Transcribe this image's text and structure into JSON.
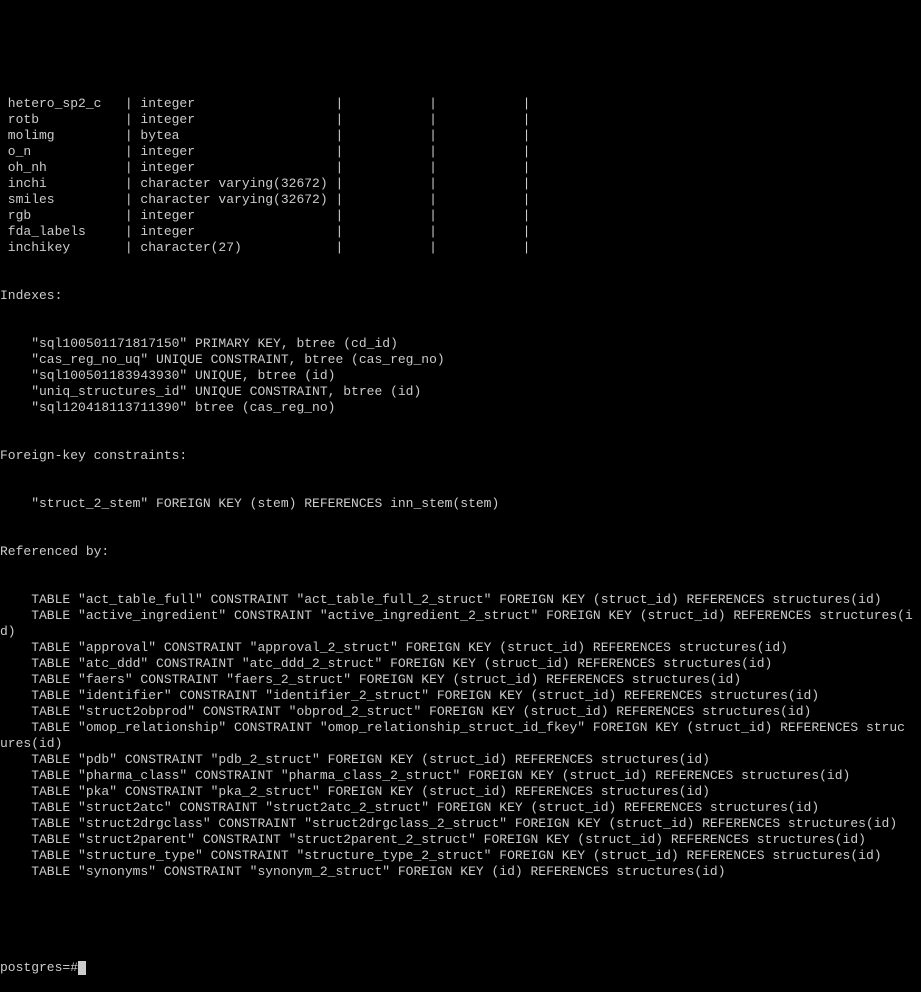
{
  "columns": [
    {
      "name": "hetero_sp2_c",
      "type": "integer",
      "md": "",
      "rest": "|           |"
    },
    {
      "name": "rotb",
      "type": "integer",
      "md": "",
      "rest": "|           |"
    },
    {
      "name": "molimg",
      "type": "bytea",
      "md": "",
      "rest": "|           |"
    },
    {
      "name": "o_n",
      "type": "integer",
      "md": "",
      "rest": "|           |"
    },
    {
      "name": "oh_nh",
      "type": "integer",
      "md": "",
      "rest": "|           |"
    },
    {
      "name": "inchi",
      "type": "character varying(32672)",
      "md": "",
      "rest": "|           |"
    },
    {
      "name": "smiles",
      "type": "character varying(32672)",
      "md": "",
      "rest": "|           |"
    },
    {
      "name": "rgb",
      "type": "integer",
      "md": "",
      "rest": "|           |"
    },
    {
      "name": "fda_labels",
      "type": "integer",
      "md": "",
      "rest": "|           |"
    },
    {
      "name": "inchikey",
      "type": "character(27)",
      "md": "",
      "rest": "|           |"
    }
  ],
  "indexes_header": "Indexes:",
  "indexes": [
    "    \"sql100501171817150\" PRIMARY KEY, btree (cd_id)",
    "    \"cas_reg_no_uq\" UNIQUE CONSTRAINT, btree (cas_reg_no)",
    "    \"sql100501183943930\" UNIQUE, btree (id)",
    "    \"uniq_structures_id\" UNIQUE CONSTRAINT, btree (id)",
    "    \"sql120418113711390\" btree (cas_reg_no)"
  ],
  "fk_header": "Foreign-key constraints:",
  "fk": [
    "    \"struct_2_stem\" FOREIGN KEY (stem) REFERENCES inn_stem(stem)"
  ],
  "ref_header": "Referenced by:",
  "refs": [
    "    TABLE \"act_table_full\" CONSTRAINT \"act_table_full_2_struct\" FOREIGN KEY (struct_id) REFERENCES structures(id)",
    "    TABLE \"active_ingredient\" CONSTRAINT \"active_ingredient_2_struct\" FOREIGN KEY (struct_id) REFERENCES structures(i",
    "d)",
    "    TABLE \"approval\" CONSTRAINT \"approval_2_struct\" FOREIGN KEY (struct_id) REFERENCES structures(id)",
    "    TABLE \"atc_ddd\" CONSTRAINT \"atc_ddd_2_struct\" FOREIGN KEY (struct_id) REFERENCES structures(id)",
    "    TABLE \"faers\" CONSTRAINT \"faers_2_struct\" FOREIGN KEY (struct_id) REFERENCES structures(id)",
    "    TABLE \"identifier\" CONSTRAINT \"identifier_2_struct\" FOREIGN KEY (struct_id) REFERENCES structures(id)",
    "    TABLE \"struct2obprod\" CONSTRAINT \"obprod_2_struct\" FOREIGN KEY (struct_id) REFERENCES structures(id)",
    "    TABLE \"omop_relationship\" CONSTRAINT \"omop_relationship_struct_id_fkey\" FOREIGN KEY (struct_id) REFERENCES struc",
    "ures(id)",
    "    TABLE \"pdb\" CONSTRAINT \"pdb_2_struct\" FOREIGN KEY (struct_id) REFERENCES structures(id)",
    "    TABLE \"pharma_class\" CONSTRAINT \"pharma_class_2_struct\" FOREIGN KEY (struct_id) REFERENCES structures(id)",
    "    TABLE \"pka\" CONSTRAINT \"pka_2_struct\" FOREIGN KEY (struct_id) REFERENCES structures(id)",
    "    TABLE \"struct2atc\" CONSTRAINT \"struct2atc_2_struct\" FOREIGN KEY (struct_id) REFERENCES structures(id)",
    "    TABLE \"struct2drgclass\" CONSTRAINT \"struct2drgclass_2_struct\" FOREIGN KEY (struct_id) REFERENCES structures(id)",
    "    TABLE \"struct2parent\" CONSTRAINT \"struct2parent_2_struct\" FOREIGN KEY (struct_id) REFERENCES structures(id)",
    "    TABLE \"structure_type\" CONSTRAINT \"structure_type_2_struct\" FOREIGN KEY (struct_id) REFERENCES structures(id)",
    "    TABLE \"synonyms\" CONSTRAINT \"synonym_2_struct\" FOREIGN KEY (id) REFERENCES structures(id)"
  ],
  "blank": "",
  "prompt": "postgres=#"
}
